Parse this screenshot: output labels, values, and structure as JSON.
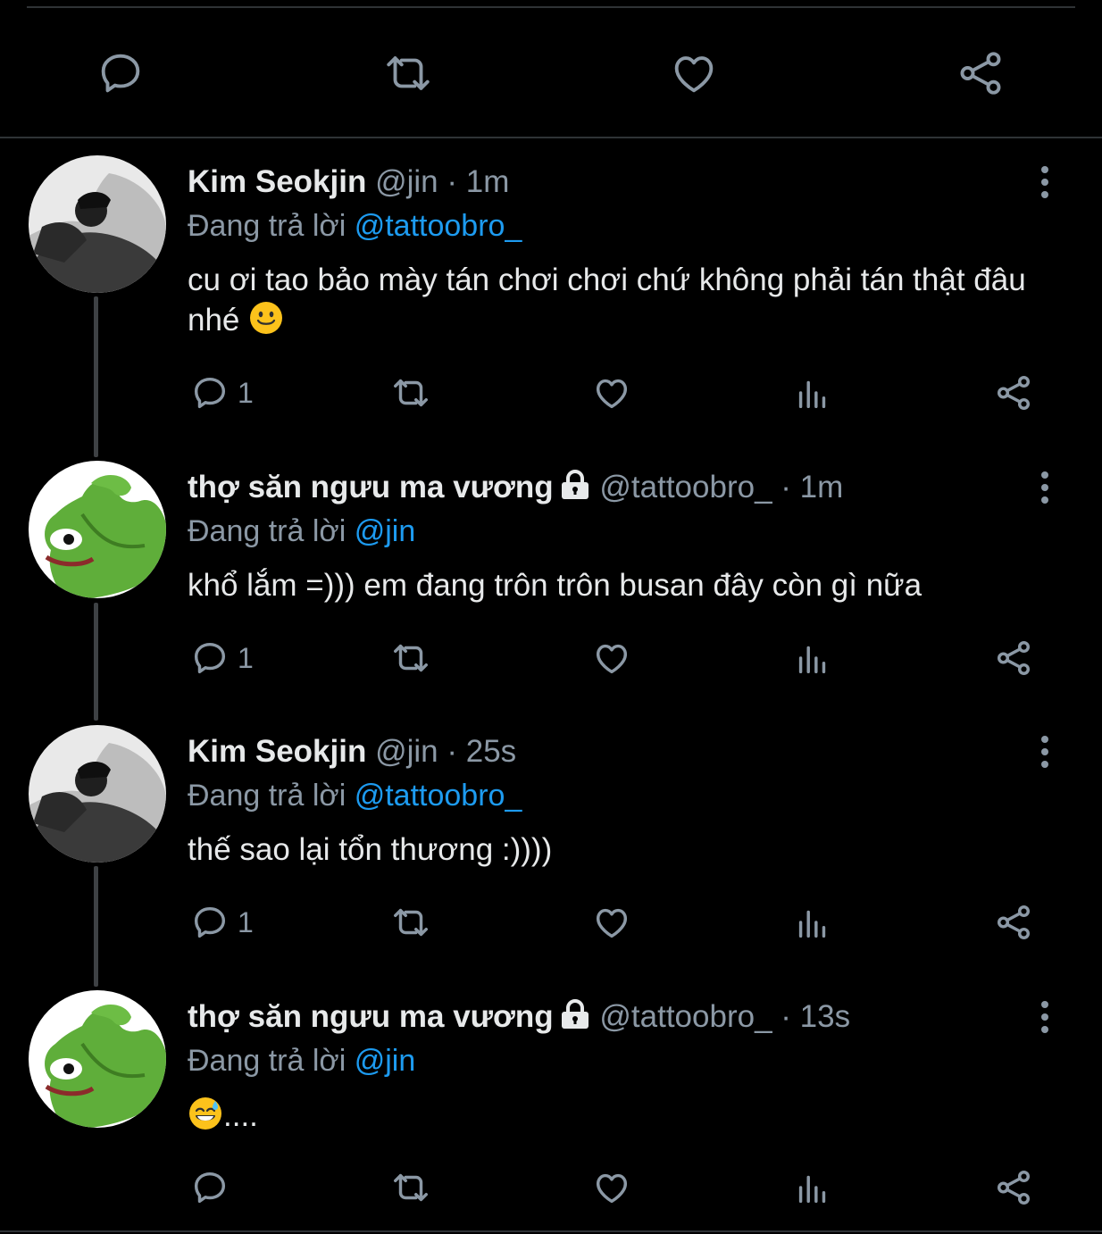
{
  "colors": {
    "background": "#000000",
    "text": "#e7e9ea",
    "muted": "#8b98a5",
    "mention": "#1d9bf0"
  },
  "top_actions": {
    "icons": [
      "reply-icon",
      "retweet-icon",
      "like-icon",
      "share-icon"
    ]
  },
  "reply_prefix": "Đang trả lời",
  "tweets": [
    {
      "name": "Kim Seokjin",
      "handle": "@jin",
      "time": "· 1m",
      "reply_to": "@tattoobro_",
      "text": "cu ơi tao bảo mày tán chơi chơi chứ không phải tán thật đâu nhé",
      "emoji": "slightly-smiling-face",
      "reply_count": "1"
    },
    {
      "name": "thợ săn ngưu ma vương",
      "locked": true,
      "handle": "@tattoobro_",
      "time": "· 1m",
      "reply_to": "@jin",
      "text": "khổ lắm =))) em đang trôn trôn busan đây còn gì nữa",
      "reply_count": "1"
    },
    {
      "name": "Kim Seokjin",
      "handle": "@jin",
      "time": "· 25s",
      "reply_to": "@tattoobro_",
      "text": "thế sao lại tổn thương :))))",
      "reply_count": "1"
    },
    {
      "name": "thợ săn ngưu ma vương",
      "locked": true,
      "handle": "@tattoobro_",
      "time": "· 13s",
      "reply_to": "@jin",
      "text": "....",
      "emoji": "grinning-face-with-sweat",
      "reply_count": ""
    }
  ]
}
